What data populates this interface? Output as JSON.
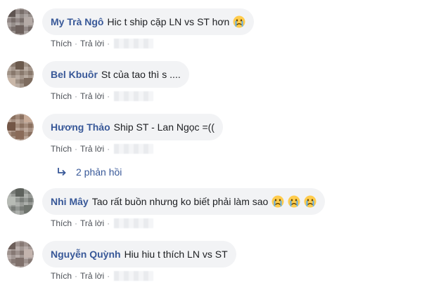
{
  "actions": {
    "like": "Thích",
    "reply": "Trả lời",
    "separator": "·"
  },
  "comments": [
    {
      "author": "My Trà Ngô",
      "text": "Hic t ship cặp LN vs ST hơn",
      "emojis": [
        "crying-face"
      ]
    },
    {
      "author": "Bel Kbuôr",
      "text": "St của tao thì s ....",
      "emojis": []
    },
    {
      "author": "Hương Thảo",
      "text": "Ship ST - Lan Ngọc =((",
      "emojis": []
    },
    {
      "author": "Nhi Mây",
      "text": "Tao rất buồn nhưng ko biết phải làm sao",
      "emojis": [
        "crying-face",
        "crying-face",
        "crying-face"
      ]
    },
    {
      "author": "Nguyễn Quỳnh",
      "text": "Hiu hiu t thích LN vs ST",
      "emojis": []
    }
  ],
  "replies": {
    "label": "2 phản hồi"
  },
  "colors": {
    "author": "#385898",
    "bubble": "#f2f3f5",
    "meta": "#4b4f56"
  }
}
